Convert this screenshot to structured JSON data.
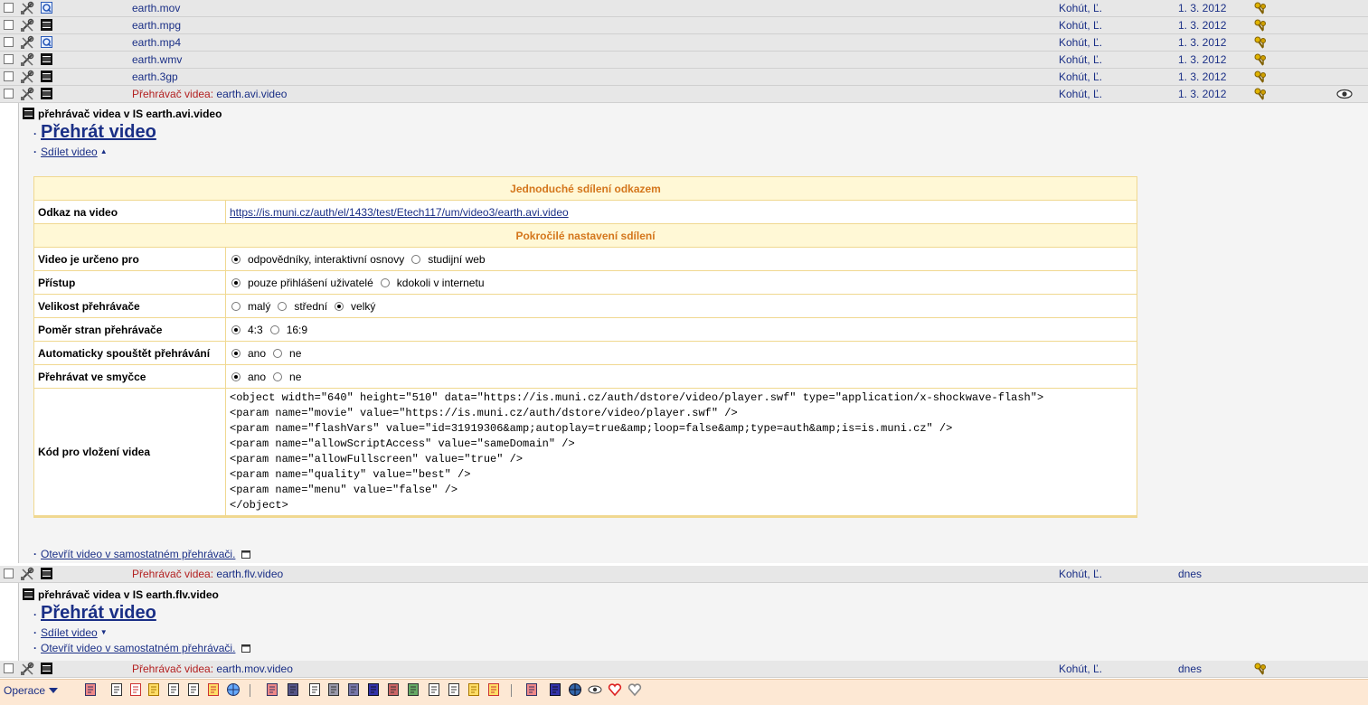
{
  "rows": [
    {
      "name": "earth.mov",
      "author": "Kohút, Ľ.",
      "date": "1.  3. 2012",
      "type": "quicktime-icon"
    },
    {
      "name": "earth.mpg",
      "author": "Kohút, Ľ.",
      "date": "1.  3. 2012",
      "type": "film-icon"
    },
    {
      "name": "earth.mp4",
      "author": "Kohút, Ľ.",
      "date": "1.  3. 2012",
      "type": "quicktime-icon"
    },
    {
      "name": "earth.wmv",
      "author": "Kohút, Ľ.",
      "date": "1.  3. 2012",
      "type": "film-icon"
    },
    {
      "name": "earth.3gp",
      "author": "Kohút, Ľ.",
      "date": "1.  3. 2012",
      "type": "film-icon"
    },
    {
      "prefix": "Přehrávač videa: ",
      "name": "earth.avi.video",
      "author": "Kohút, Ľ.",
      "date": "1.  3. 2012",
      "type": "film-icon"
    },
    {
      "prefix": "Přehrávač videa: ",
      "name": "earth.flv.video",
      "author": "Kohút, Ľ.",
      "date": "dnes",
      "type": "film-icon"
    },
    {
      "prefix": "Přehrávač videa: ",
      "name": "earth.mov.video",
      "author": "Kohút, Ľ.",
      "date": "dnes",
      "type": "film-icon"
    }
  ],
  "panel1": {
    "title": "přehrávač videa v IS earth.avi.video",
    "play": "Přehrát video",
    "share": "Sdílet video",
    "open": "Otevřít video v samostatném přehrávači."
  },
  "share": {
    "simple_header": "Jednoduché sdílení odkazem",
    "link_label": "Odkaz na video",
    "link": "https://is.muni.cz/auth/el/1433/test/Etech117/um/video3/earth.avi.video",
    "advanced_header": "Pokročilé nastavení sdílení",
    "settings": [
      {
        "label": "Video je určeno pro",
        "options": [
          "odpovědníky, interaktivní osnovy",
          "studijní web"
        ],
        "selected": 0
      },
      {
        "label": "Přístup",
        "options": [
          "pouze přihlášení uživatelé",
          "kdokoli v internetu"
        ],
        "selected": 0
      },
      {
        "label": "Velikost přehrávače",
        "options": [
          "malý",
          "střední",
          "velký"
        ],
        "selected": 2
      },
      {
        "label": "Poměr stran přehrávače",
        "options": [
          "4:3",
          "16:9"
        ],
        "selected": 0
      },
      {
        "label": "Automaticky spouštět přehrávání",
        "options": [
          "ano",
          "ne"
        ],
        "selected": 0
      },
      {
        "label": "Přehrávat ve smyčce",
        "options": [
          "ano",
          "ne"
        ],
        "selected": 0
      }
    ],
    "embed_label": "Kód pro vložení videa",
    "embed_code": "<object width=\"640\" height=\"510\" data=\"https://is.muni.cz/auth/dstore/video/player.swf\" type=\"application/x-shockwave-flash\">\n<param name=\"movie\" value=\"https://is.muni.cz/auth/dstore/video/player.swf\" />\n<param name=\"flashVars\" value=\"id=31919306&amp;autoplay=true&amp;loop=false&amp;type=auth&amp;is=is.muni.cz\" />\n<param name=\"allowScriptAccess\" value=\"sameDomain\" />\n<param name=\"allowFullscreen\" value=\"true\" />\n<param name=\"quality\" value=\"best\" />\n<param name=\"menu\" value=\"false\" />\n</object>"
  },
  "panel2": {
    "title": "přehrávač videa v IS earth.flv.video",
    "play": "Přehrát video",
    "share": "Sdílet video",
    "open": "Otevřít video v samostatném přehrávači."
  },
  "toolbar": {
    "ops_label": "Operace"
  },
  "colors": {
    "link": "#1a2f86",
    "prefix": "#b32020",
    "header_text": "#d4761c",
    "table_border": "#f0d890",
    "toolbar_bg": "#fde8d4"
  }
}
